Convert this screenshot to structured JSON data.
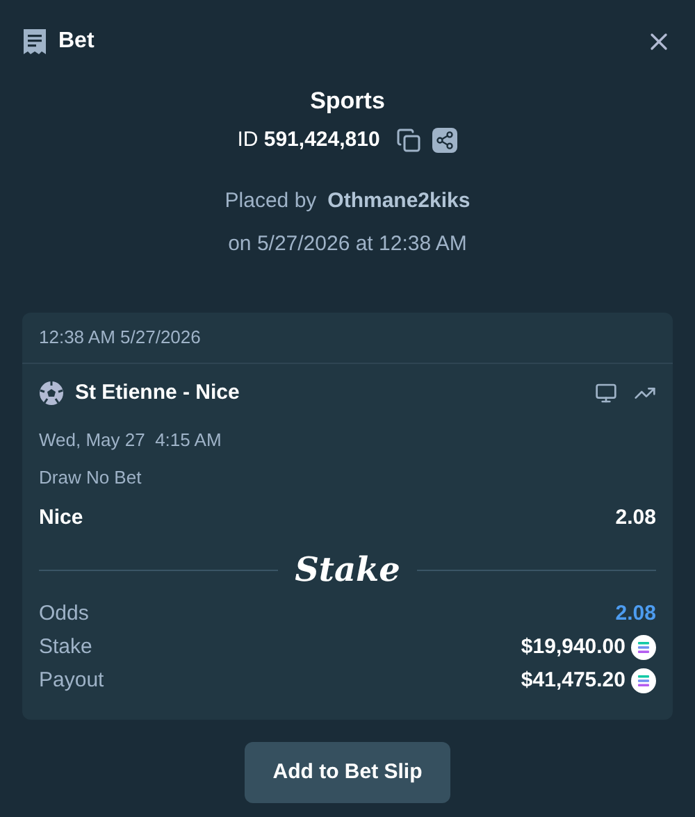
{
  "header": {
    "title": "Bet"
  },
  "bet": {
    "category": "Sports",
    "id_label": "ID",
    "id": "591,424,810",
    "placed_by_label": "Placed by",
    "user": "Othmane2kiks",
    "placed_on": "on 5/27/2026 at 12:38 AM"
  },
  "card": {
    "timestamp": "12:38 AM 5/27/2026",
    "event": "St Etienne - Nice",
    "start_time": "Wed, May 27  4:15 AM",
    "market": "Draw No Bet",
    "selection": "Nice",
    "selection_odds": "2.08",
    "logo": "Stake",
    "summary": [
      {
        "label": "Odds",
        "value": "2.08",
        "kind": "odds"
      },
      {
        "label": "Stake",
        "value": "$19,940.00",
        "kind": "currency"
      },
      {
        "label": "Payout",
        "value": "$41,475.20",
        "kind": "currency"
      }
    ]
  },
  "button": "Add to Bet Slip"
}
